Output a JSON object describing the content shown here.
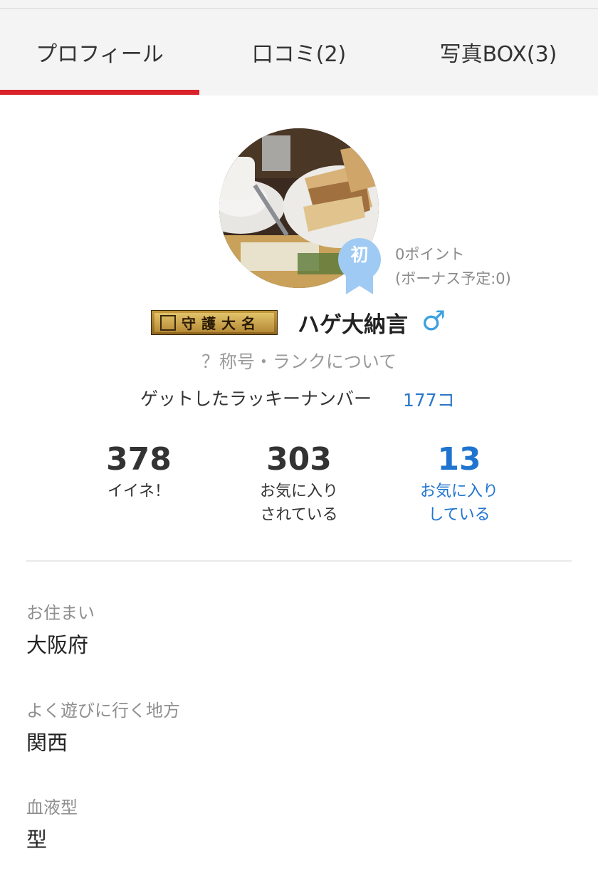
{
  "tabs": [
    {
      "label": "プロフィール",
      "active": true
    },
    {
      "label": "口コミ(2)",
      "active": false
    },
    {
      "label": "写真BOX(3)",
      "active": false
    }
  ],
  "colors": {
    "accent_red": "#d9222a",
    "link_blue": "#1f74d0",
    "badge_blue": "#9fcaf3",
    "gender_blue": "#3aa0e0"
  },
  "profile": {
    "badge_char": "初",
    "points": "0ポイント",
    "bonus": "(ボーナス予定:0)",
    "rank_title": "守護大名",
    "username": "ハゲ大納言",
    "gender_symbol": "♂",
    "rank_help_link": "？称号・ランクについて",
    "lucky_label": "ゲットしたラッキーナンバー",
    "lucky_count": "177コ"
  },
  "stats": [
    {
      "value": "378",
      "label_line1": "イイネ！",
      "label_line2": ""
    },
    {
      "value": "303",
      "label_line1": "お気に入り",
      "label_line2": "されている"
    },
    {
      "value": "13",
      "label_line1": "お気に入り",
      "label_line2": "している"
    }
  ],
  "fields": [
    {
      "label": "お住まい",
      "value": "大阪府"
    },
    {
      "label": "よく遊びに行く地方",
      "value": "関西"
    },
    {
      "label": "血液型",
      "value": "型"
    }
  ],
  "icons": {
    "avatar": "avatar-photo",
    "badge": "ribbon-badge-icon",
    "gender": "male-icon"
  }
}
